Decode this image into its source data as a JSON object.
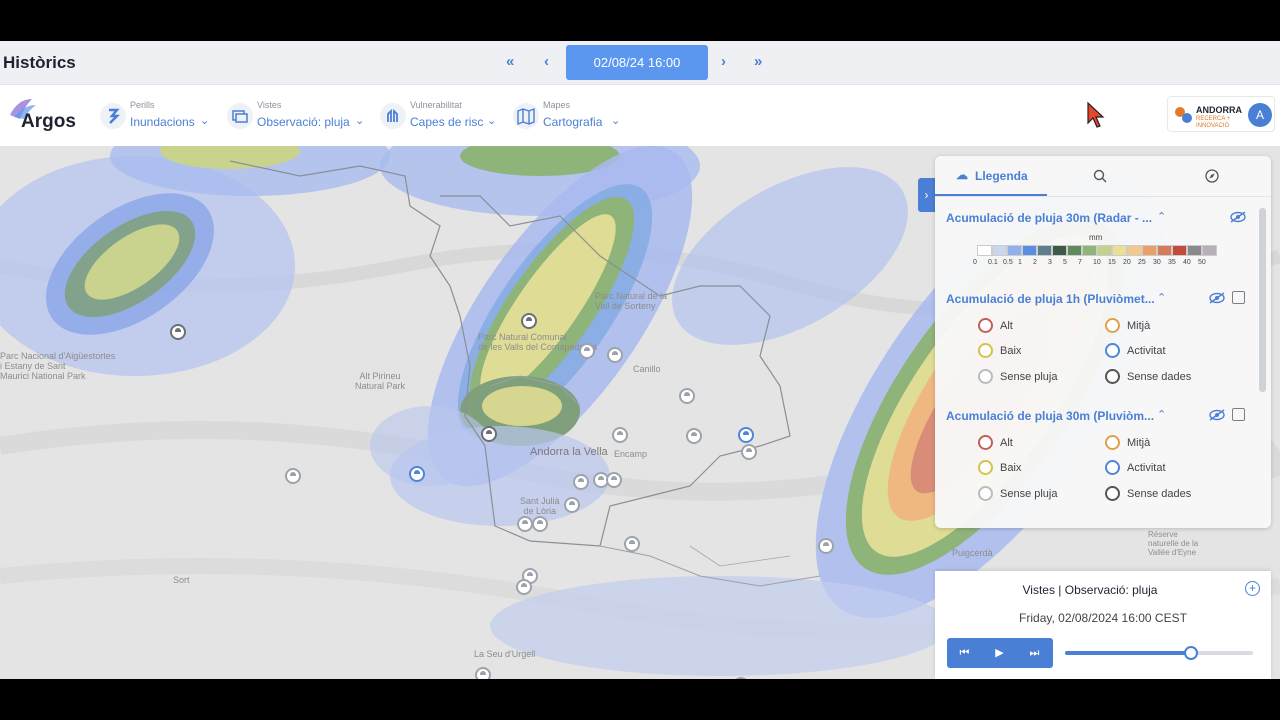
{
  "header": {
    "title": "Històrics",
    "nav_first": "«",
    "nav_prev": "‹",
    "date": "02/08/24 16:00",
    "nav_next": "›",
    "nav_last": "»"
  },
  "app": {
    "logo_text": "Argos"
  },
  "menus": [
    {
      "caption": "Perills",
      "value": "Inundacions",
      "icon": "hazard-icon"
    },
    {
      "caption": "Vistes",
      "value": "Observació: pluja",
      "icon": "views-icon"
    },
    {
      "caption": "Vulnerabilitat",
      "value": "Capes de risc",
      "icon": "vulnerability-icon"
    },
    {
      "caption": "Mapes",
      "value": "Cartografia",
      "icon": "map-icon"
    }
  ],
  "partner": {
    "line1": "ANDORRA",
    "line2": "RECERCA +",
    "line3": "INNOVACIÓ",
    "avatar": "A"
  },
  "map_labels": {
    "andorra": "Andorra la Vella",
    "sant_julia_1": "Sant Julià",
    "sant_julia_2": "de Lòria",
    "encamp": "Encamp",
    "canillo": "Canillo",
    "alt_pirineu_1": "Alt Pirineu",
    "alt_pirineu_2": "Natural Park",
    "sant_maurici_1": "Parc Nacional d'Aigüestortes",
    "sant_maurici_2": "i Estany de Sant",
    "sant_maurici_3": "Maurici National Park",
    "la_seu": "La Seu d'Urgell",
    "sort": "Sort",
    "puigcerda": "Puigcerdà",
    "reserve_1": "Réserve",
    "reserve_2": "naturelle de la",
    "reserve_3": "Vallée d'Eyne",
    "parc_valls": "Parc Natural de la",
    "parc_valls_2": "Vall de Sorteny",
    "parc_comapedrosa": "Parc Natural Comunal",
    "parc_comapedrosa_2": "de les Valls del Comapedrosa"
  },
  "legend": {
    "tab_legend": "Llegenda",
    "sections": [
      {
        "title": "Acumulació de pluja 30m (Radar - ..."
      },
      {
        "title": "Acumulació de pluja 1h (Pluviòmet..."
      },
      {
        "title": "Acumulació de pluja 30m (Pluviòm..."
      }
    ],
    "scale_unit": "mm",
    "scale_labels": [
      "0",
      "0.1",
      "0.5",
      "1",
      "2",
      "3",
      "5",
      "7",
      "10",
      "15",
      "20",
      "25",
      "30",
      "35",
      "40",
      "50"
    ],
    "scale_colors": [
      "#ffffff",
      "#c8d6ef",
      "#8fb0ec",
      "#5b8ee0",
      "#5f7f8f",
      "#3f5a48",
      "#5e8a5d",
      "#8fb47a",
      "#c3d08e",
      "#e9df97",
      "#f1c98a",
      "#ea9f6a",
      "#d57b5c",
      "#c14c3c",
      "#8a8a8a",
      "#b8b0b8"
    ],
    "items": [
      {
        "label": "Alt",
        "color": "#c0605a"
      },
      {
        "label": "Mitjà",
        "color": "#e0a04a"
      },
      {
        "label": "Baix",
        "color": "#d6c24a"
      },
      {
        "label": "Activitat",
        "color": "#4f86d6"
      },
      {
        "label": "Sense pluja",
        "color": "#bcbcbc"
      },
      {
        "label": "Sense dades",
        "color": "#555555"
      }
    ]
  },
  "player": {
    "title": "Vistes | Observació: pluja",
    "time": "Friday, 02/08/2024 16:00 CEST",
    "progress": 0.67
  }
}
